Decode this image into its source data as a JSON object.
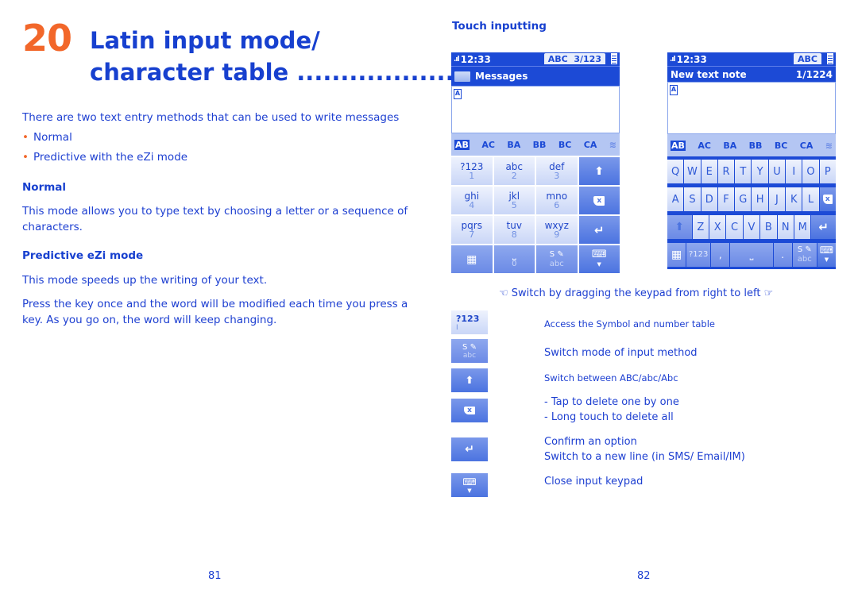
{
  "left_page": {
    "chapter_number": "20",
    "title_line1": "Latin input mode/",
    "title_line2": "character table ..................",
    "intro": "There are two text entry methods that can be used to write messages",
    "bullets": [
      "Normal",
      "Predictive with the eZi mode"
    ],
    "normal_heading": "Normal",
    "normal_text_line1": "This mode allows you to type text by choosing a letter or a sequence of",
    "normal_text_line2": "characters.",
    "predictive_heading": "Predictive eZi mode",
    "predictive_text": "This mode speeds up the writing of your text.",
    "press_text_line1": "Press the key once and the word will be modified each time you press a",
    "press_text_line2": "key.  As you go on, the word will keep changing.",
    "page_number": "81"
  },
  "right_page": {
    "heading": "Touch inputting",
    "screen1": {
      "time": "12:33",
      "mode": "ABC",
      "counter": "3/123",
      "title": "Messages",
      "cursor": "A",
      "candidates": [
        "AB",
        "AC",
        "BA",
        "BB",
        "BC",
        "CA",
        "≋"
      ],
      "keys": [
        {
          "label": "?123",
          "num": "1"
        },
        {
          "label": "abc",
          "num": "2"
        },
        {
          "label": "def",
          "num": "3"
        },
        {
          "label": "ghi",
          "num": "4"
        },
        {
          "label": "jkl",
          "num": "5"
        },
        {
          "label": "mno",
          "num": "6"
        },
        {
          "label": "pqrs",
          "num": "7"
        },
        {
          "label": "tuv",
          "num": "8"
        },
        {
          "label": "wxyz",
          "num": "9"
        },
        {
          "label": "⎵",
          "num": "0"
        }
      ]
    },
    "screen2": {
      "time": "12:33",
      "mode": "ABC",
      "title": "New text note",
      "counter": "1/1224",
      "cursor": "A",
      "candidates": [
        "AB",
        "AC",
        "BA",
        "BB",
        "BC",
        "CA",
        "≋"
      ],
      "row1": [
        "Q",
        "W",
        "E",
        "R",
        "T",
        "Y",
        "U",
        "I",
        "O",
        "P"
      ],
      "row2": [
        "A",
        "S",
        "D",
        "F",
        "G",
        "H",
        "J",
        "K",
        "L"
      ],
      "row3": [
        "Z",
        "X",
        "C",
        "V",
        "B",
        "N",
        "M"
      ],
      "row4": {
        "sym": "?123",
        "comma": ",",
        "space": "⎵",
        "dot": "."
      }
    },
    "switch_hint": "Switch by dragging the keypad from right to left",
    "legend": [
      {
        "key": "?123",
        "text": "Access the Symbol and number table"
      },
      {
        "key": "S/abc",
        "text": "Switch mode of input method"
      },
      {
        "key": "↑",
        "text": "Switch between ABC/abc/Abc"
      },
      {
        "key": "⌫",
        "text": "- Tap to delete one by one",
        "text2": "- Long touch to delete all"
      },
      {
        "key": "↵",
        "text": "Confirm an option",
        "text2": "Switch to a new line (in SMS/ Email/IM)"
      },
      {
        "key": "⌨",
        "text": "Close input keypad"
      }
    ],
    "page_number": "82"
  },
  "colors": {
    "accent": "#f2672a",
    "text": "#1d3fd1",
    "phone_blue": "#1c4ad6"
  }
}
